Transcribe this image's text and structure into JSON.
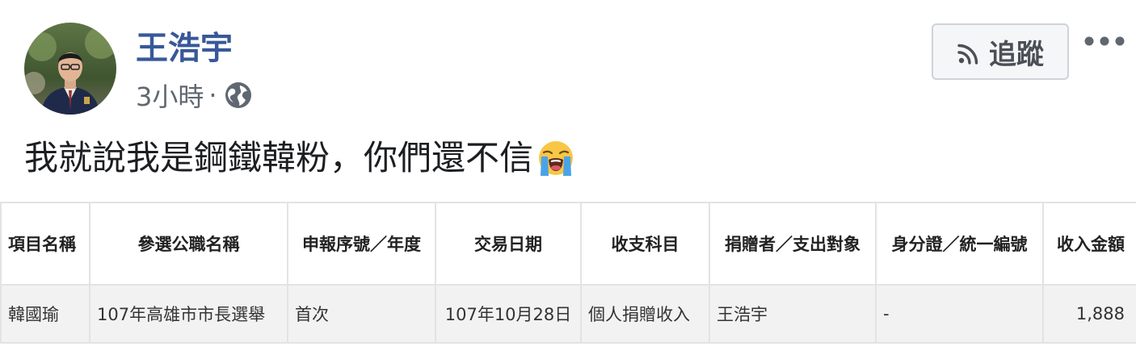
{
  "post": {
    "author": "王浩宇",
    "time": "3小時",
    "separator": "·",
    "privacy_icon": "globe-icon",
    "follow_label": "追蹤",
    "follow_icon": "rss-icon",
    "more_icon": "more-dots-icon",
    "text": "我就說我是鋼鐵韓粉，你們還不信",
    "emoji": "loudly-crying-face-emoji"
  },
  "table": {
    "headers": [
      "項目名稱",
      "參選公職名稱",
      "申報序號／年度",
      "交易日期",
      "收支科目",
      "捐贈者／支出對象",
      "身分證／統一編號",
      "收入金額"
    ],
    "rows": [
      [
        "韓國瑜",
        "107年高雄市市長選舉",
        "首次",
        "107年10月28日",
        "個人捐贈收入",
        "王浩宇",
        "-",
        "1,888"
      ]
    ]
  },
  "colors": {
    "author_link": "#385898",
    "meta_gray": "#606770",
    "button_bg": "#f5f6f7",
    "row_bg": "#f2f2f2",
    "border": "#e3e3e3"
  }
}
